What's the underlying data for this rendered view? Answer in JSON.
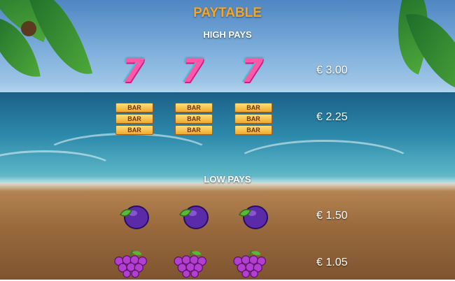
{
  "paytable": {
    "title": "PAYTABLE",
    "high_pays_label": "HIGH PAYS",
    "low_pays_label": "LOW PAYS",
    "rows": [
      {
        "symbol": "seven-icon",
        "count": 3,
        "glyph": "7",
        "payout": "€ 3.00"
      },
      {
        "symbol": "bar-icon",
        "count": 3,
        "glyph": "BAR",
        "payout": "€ 2.25"
      },
      {
        "symbol": "plum-icon",
        "count": 3,
        "payout": "€ 1.50"
      },
      {
        "symbol": "grapes-icon",
        "count": 3,
        "payout": "€ 1.05"
      }
    ]
  },
  "colors": {
    "title": "#f5a623",
    "text": "#ffffff",
    "seven": "#ff58a8",
    "bar_gold": "#f0a92a",
    "plum": "#5b2aa8",
    "grapes": "#b23fd0"
  }
}
